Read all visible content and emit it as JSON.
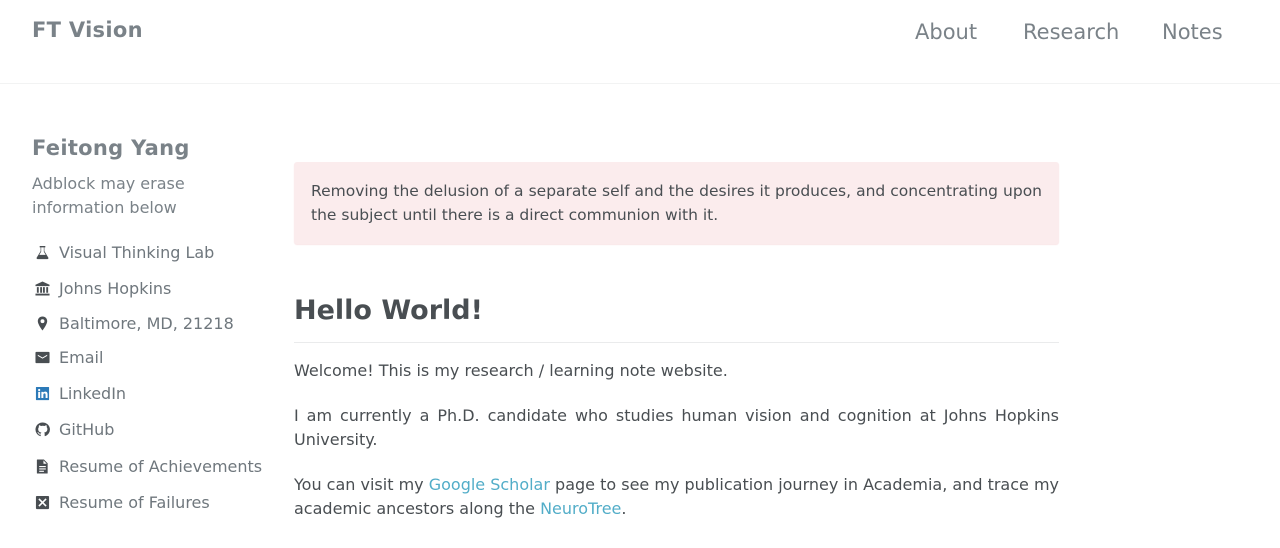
{
  "site": {
    "title": "FT Vision"
  },
  "nav": {
    "items": [
      "About",
      "Research",
      "Notes"
    ]
  },
  "sidebar": {
    "name": "Feitong Yang",
    "bio": "Adblock may erase information below",
    "links": [
      {
        "icon": "flask-icon",
        "label": "Visual Thinking Lab"
      },
      {
        "icon": "university-icon",
        "label": "Johns Hopkins"
      },
      {
        "icon": "map-marker-icon",
        "label": "Baltimore, MD, 21218"
      },
      {
        "icon": "envelope-icon",
        "label": "Email"
      },
      {
        "icon": "linkedin-icon",
        "label": "LinkedIn",
        "color": "#2c7ab8"
      },
      {
        "icon": "github-icon",
        "label": "GitHub"
      },
      {
        "icon": "file-text-icon",
        "label": "Resume of Achievements"
      },
      {
        "icon": "close-box-icon",
        "label": "Resume of Failures"
      }
    ]
  },
  "main": {
    "notice": "Removing the delusion of a separate self and the desires it produces, and concentrating upon the subject until there is a direct communion with it.",
    "title": "Hello World!",
    "para1": "Welcome! This is my research / learning note website.",
    "para2": "I am currently a Ph.D. candidate who studies human vision and cognition at Johns Hopkins University.",
    "para3": {
      "before": "You can visit my ",
      "link1": "Google Scholar",
      "middle": " page to see my publication journey in Academia, and trace my academic ancestors along the ",
      "link2": "NeuroTree",
      "after": "."
    }
  },
  "colors": {
    "link": "#52adc8",
    "notice_bg": "#fbeced",
    "muted_text": "#7a8288"
  }
}
